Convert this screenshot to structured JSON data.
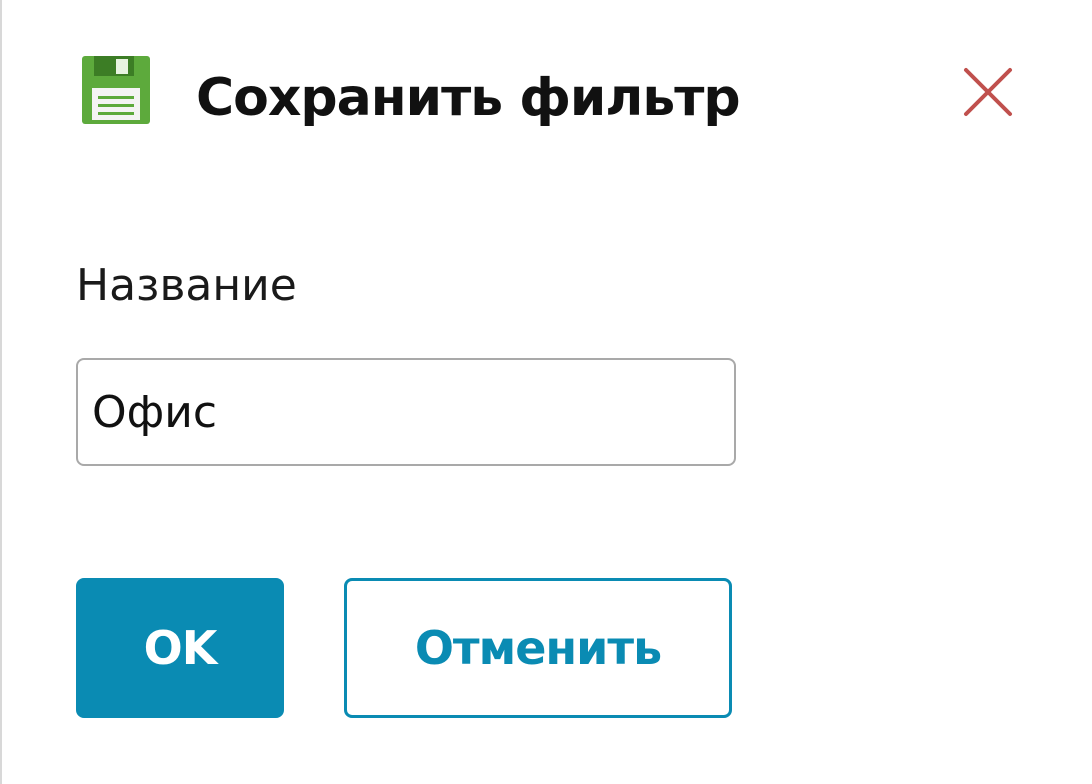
{
  "dialog": {
    "title": "Сохранить фильтр",
    "icon": "floppy-disk-save-icon",
    "close_icon": "close-x-icon"
  },
  "form": {
    "name_label": "Название",
    "name_value": "Офис"
  },
  "buttons": {
    "ok_label": "OK",
    "cancel_label": "Отменить"
  },
  "colors": {
    "accent": "#0a8bb3",
    "close": "#c0504d",
    "icon_green": "#5daa3c"
  }
}
